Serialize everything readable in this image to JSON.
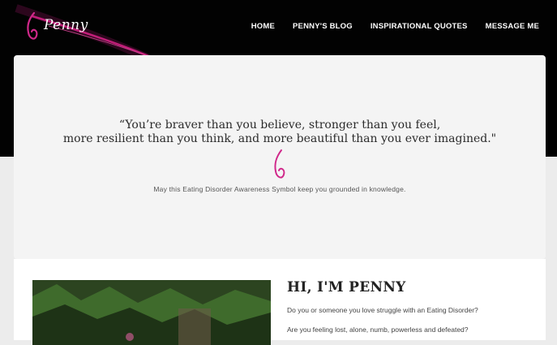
{
  "brand": {
    "name": "Penny"
  },
  "nav": {
    "items": [
      {
        "label": "HOME"
      },
      {
        "label": "PENNY'S BLOG"
      },
      {
        "label": "INSPIRATIONAL QUOTES"
      },
      {
        "label": "MESSAGE ME"
      }
    ]
  },
  "hero": {
    "quote_line1": "“You’re braver than you believe, stronger than you feel,",
    "quote_line2": "more resilient than you think, and more beautiful than you ever imagined.\"",
    "caption": "May this Eating Disorder Awareness Symbol keep you grounded in knowledge."
  },
  "about": {
    "title": "HI, I'M PENNY",
    "p1": "Do you or someone you love struggle with an Eating Disorder?",
    "p2": "Are you feeling lost, alone, numb, powerless and defeated?"
  },
  "colors": {
    "accent": "#d0288a",
    "header_bg": "#020202"
  },
  "icons": {
    "logo": "eating-disorder-awareness-symbol-icon"
  }
}
